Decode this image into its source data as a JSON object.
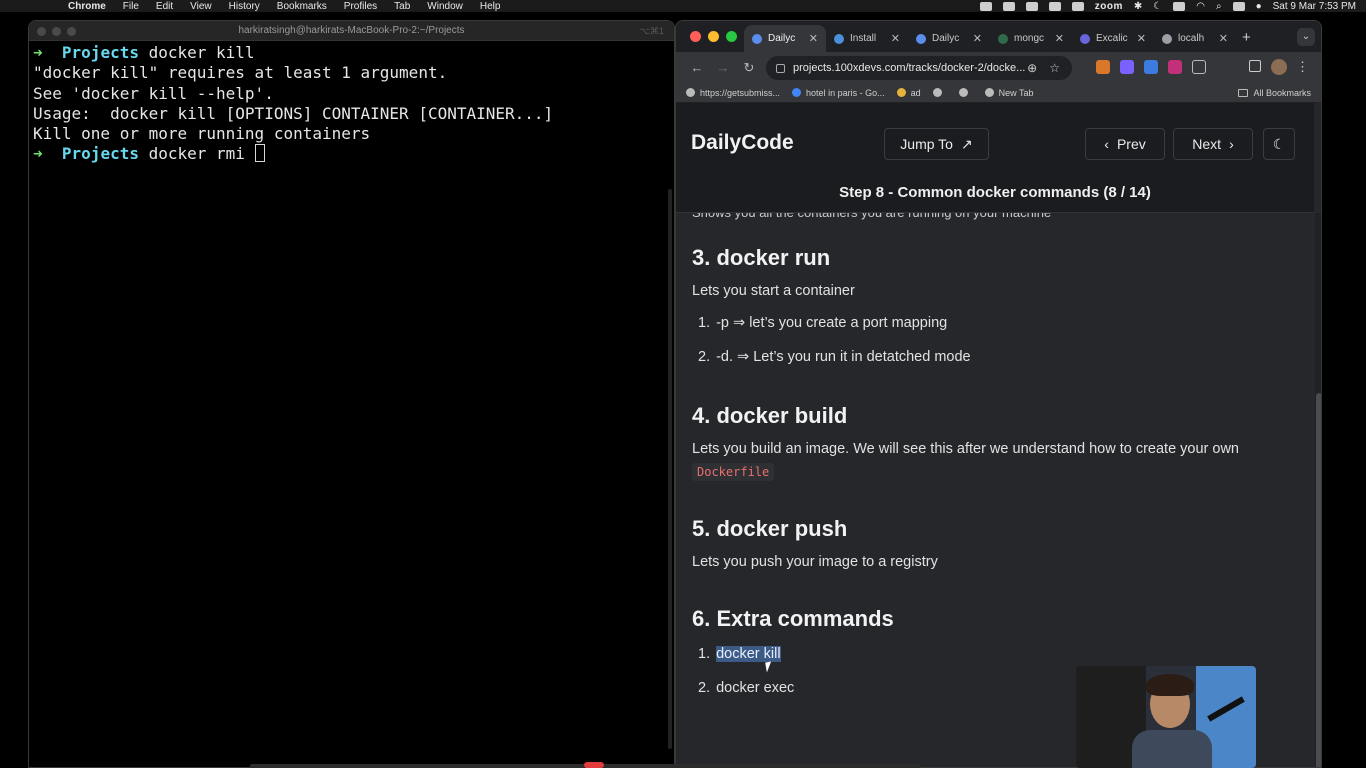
{
  "menubar": {
    "app_name": "Chrome",
    "items": [
      "File",
      "Edit",
      "View",
      "History",
      "Bookmarks",
      "Profiles",
      "Tab",
      "Window",
      "Help"
    ],
    "zoom_label": "zoom",
    "datetime": "Sat 9 Mar  7:53 PM"
  },
  "terminal": {
    "title": "harkiratsingh@harkirats-MacBook-Pro-2:~/Projects",
    "shortcut": "⌥⌘1",
    "lines": [
      {
        "prompt": "➜",
        "dir": "Projects",
        "text": " docker kill"
      },
      {
        "text": "\"docker kill\" requires at least 1 argument."
      },
      {
        "text": "See 'docker kill --help'."
      },
      {
        "text": ""
      },
      {
        "text": "Usage:  docker kill [OPTIONS] CONTAINER [CONTAINER...]"
      },
      {
        "text": ""
      },
      {
        "text": "Kill one or more running containers"
      },
      {
        "prompt": "➜",
        "dir": "Projects",
        "text": " docker rmi "
      }
    ]
  },
  "browser": {
    "tabs": [
      {
        "label": "Dailyc",
        "color": "#5b8def",
        "active": true
      },
      {
        "label": "Install",
        "color": "#4a90d9",
        "active": false
      },
      {
        "label": "Dailyc",
        "color": "#5b8def",
        "active": false
      },
      {
        "label": "mongc",
        "color": "#2f6a4b",
        "active": false
      },
      {
        "label": "Excalic",
        "color": "#6965db",
        "active": false
      },
      {
        "label": "localh",
        "color": "#9aa0a6",
        "active": false
      }
    ],
    "new_tab": "+",
    "url": "projects.100xdevs.com/tracks/docker-2/docke...",
    "bookmarks": [
      {
        "label": "https://getsubmiss..."
      },
      {
        "label": "hotel in paris - Go..."
      },
      {
        "label": "ad"
      },
      {
        "label": ""
      },
      {
        "label": ""
      },
      {
        "label": "New Tab"
      }
    ],
    "all_bookmarks": "All Bookmarks"
  },
  "site": {
    "logo": "DailyCode",
    "jump_to": "Jump To",
    "prev": "Prev",
    "next": "Next",
    "step_title": "Step 8 - Common docker commands (8 / 14)",
    "partial_line": "Shows you all the containers you are running on your machine",
    "sections": {
      "run": {
        "heading": "3. docker run",
        "desc": "Lets you start a container",
        "items": [
          {
            "num": "1.",
            "text": "-p ⇒ let’s you create a port mapping"
          },
          {
            "num": "2.",
            "text": "-d. ⇒ Let’s you run it in detatched mode"
          }
        ]
      },
      "build": {
        "heading": "4. docker build",
        "desc": "Lets you build an image. We will see this after we understand how to create your own",
        "code": "Dockerfile"
      },
      "push": {
        "heading": "5. docker push",
        "desc": "Lets you push your image to a registry"
      },
      "extra": {
        "heading": "6. Extra commands",
        "items": [
          {
            "num": "1.",
            "text": "docker kill"
          },
          {
            "num": "2.",
            "text": "docker exec"
          }
        ]
      }
    }
  },
  "colors": {
    "prompt_arrow": "#6fe36f",
    "prompt_dir": "#68d9ee",
    "code_text": "#ea6f6f",
    "selection": "#3c5a86"
  }
}
